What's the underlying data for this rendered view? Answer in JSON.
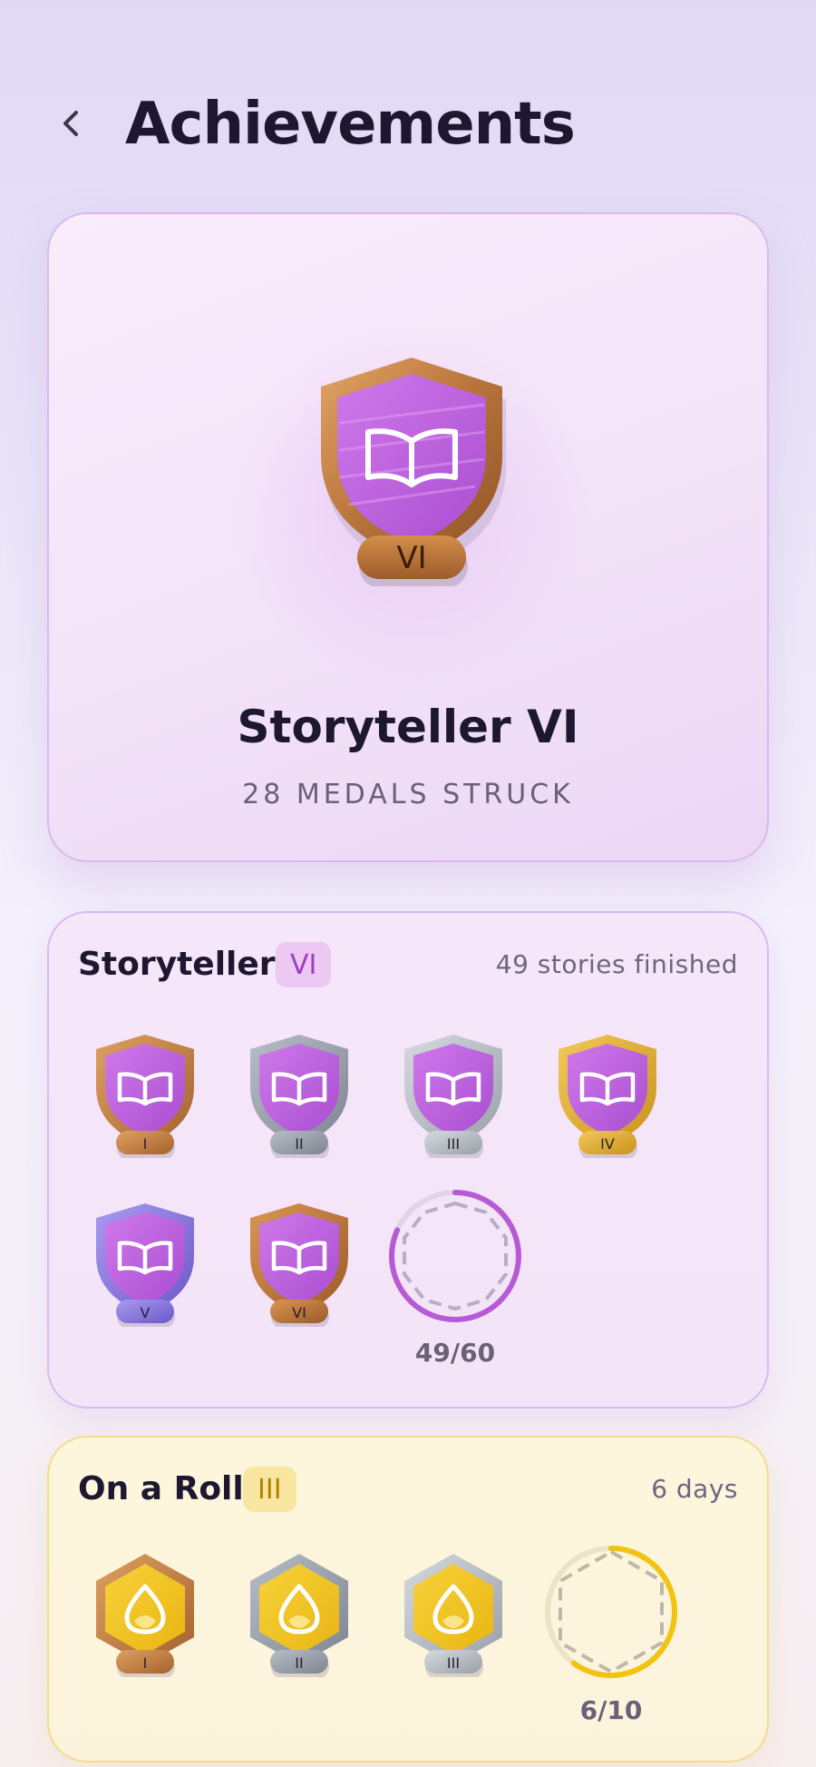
{
  "header": {
    "title": "Achievements",
    "back_icon": "chevron-left-icon"
  },
  "hero": {
    "medal_tier": "VI",
    "title": "Storyteller VI",
    "subtitle": "28 MEDALS STRUCK",
    "medal_icon": "open-book-icon"
  },
  "storyteller": {
    "title": "Storyteller",
    "tier": "VI",
    "meta": "49 stories finished",
    "medals": [
      "I",
      "II",
      "III",
      "IV",
      "V",
      "VI"
    ],
    "progress_label": "49/60",
    "progress_value": 49,
    "progress_max": 60,
    "accent": "#b65ad6"
  },
  "on_a_roll": {
    "title": "On a Roll",
    "tier": "III",
    "meta": "6 days",
    "medals": [
      "I",
      "II",
      "III"
    ],
    "progress_label": "6/10",
    "progress_value": 6,
    "progress_max": 10,
    "accent": "#f1c40f"
  },
  "colors": {
    "bronze": "#c07a3a",
    "silver": "#9aa1ab",
    "gold": "#e0a41c",
    "purple": "#b65ad6",
    "amethyst": "#8c6ad8"
  }
}
